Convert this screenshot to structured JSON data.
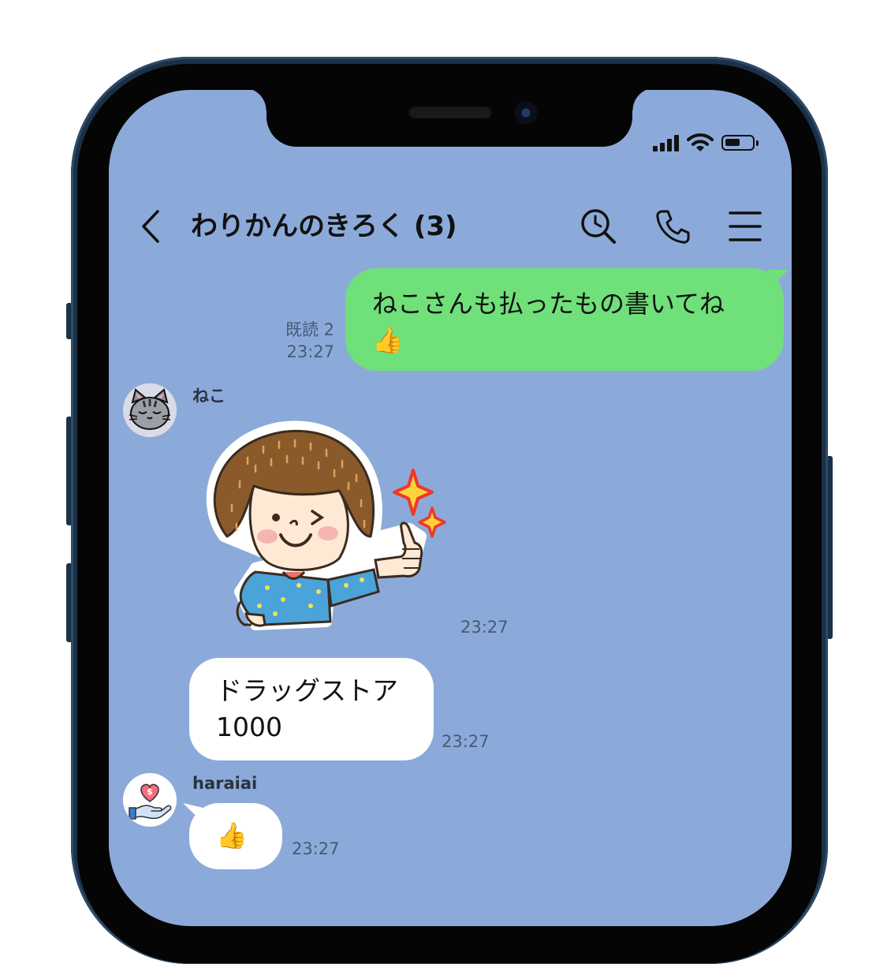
{
  "status": {
    "signal_icon": "signal-bars-icon",
    "wifi_icon": "wifi-icon",
    "battery_icon": "battery-icon"
  },
  "header": {
    "title": "わりかんのきろく (3)",
    "back_icon": "chevron-left-icon",
    "search_icon": "search-icon",
    "call_icon": "phone-icon",
    "menu_icon": "menu-icon"
  },
  "messages": [
    {
      "type": "outgoing",
      "text": "ねこさんも払ったもの書いてね",
      "emoji": "👍",
      "read_label": "既読 2",
      "time": "23:27"
    },
    {
      "type": "incoming-sticker",
      "sender": "ねこ",
      "avatar_icon": "cat-avatar-icon",
      "sticker_icon": "thumbs-up-girl-sticker",
      "time": "23:27"
    },
    {
      "type": "incoming",
      "text_line1": "ドラッグストア",
      "text_line2": "1000",
      "time": "23:27"
    },
    {
      "type": "incoming",
      "sender": "haraiai",
      "avatar_icon": "heart-money-hand-icon",
      "emoji": "👍",
      "time": "23:27"
    }
  ],
  "colors": {
    "chat_background": "#8caad9",
    "outgoing_bubble": "#70e07a",
    "incoming_bubble": "#ffffff",
    "phone_frame": "#1b3147"
  }
}
